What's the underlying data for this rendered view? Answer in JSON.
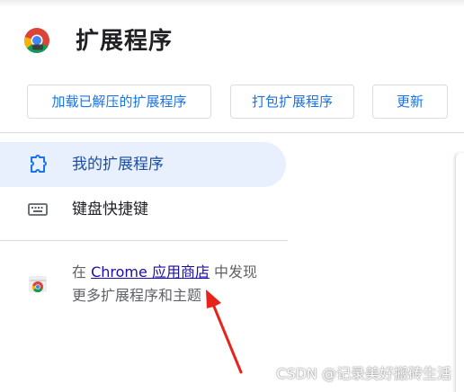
{
  "header": {
    "title": "扩展程序",
    "buttons": {
      "load_unpacked": "加载已解压的扩展程序",
      "pack": "打包扩展程序",
      "update": "更新"
    }
  },
  "sidebar": {
    "items": [
      {
        "label": "我的扩展程序",
        "icon": "puzzle-icon",
        "selected": true
      },
      {
        "label": "键盘快捷键",
        "icon": "keyboard-icon",
        "selected": false
      }
    ],
    "store_promo": {
      "prefix": "在 ",
      "link": "Chrome 应用商店",
      "suffix": " 中发现",
      "line2": "更多扩展程序和主题"
    }
  },
  "watermark": "CSDN @记录美好搬砖生活",
  "colors": {
    "accent": "#1a73e8",
    "selected_bg": "#e8f0fe",
    "annotation_arrow": "#e8231a"
  }
}
